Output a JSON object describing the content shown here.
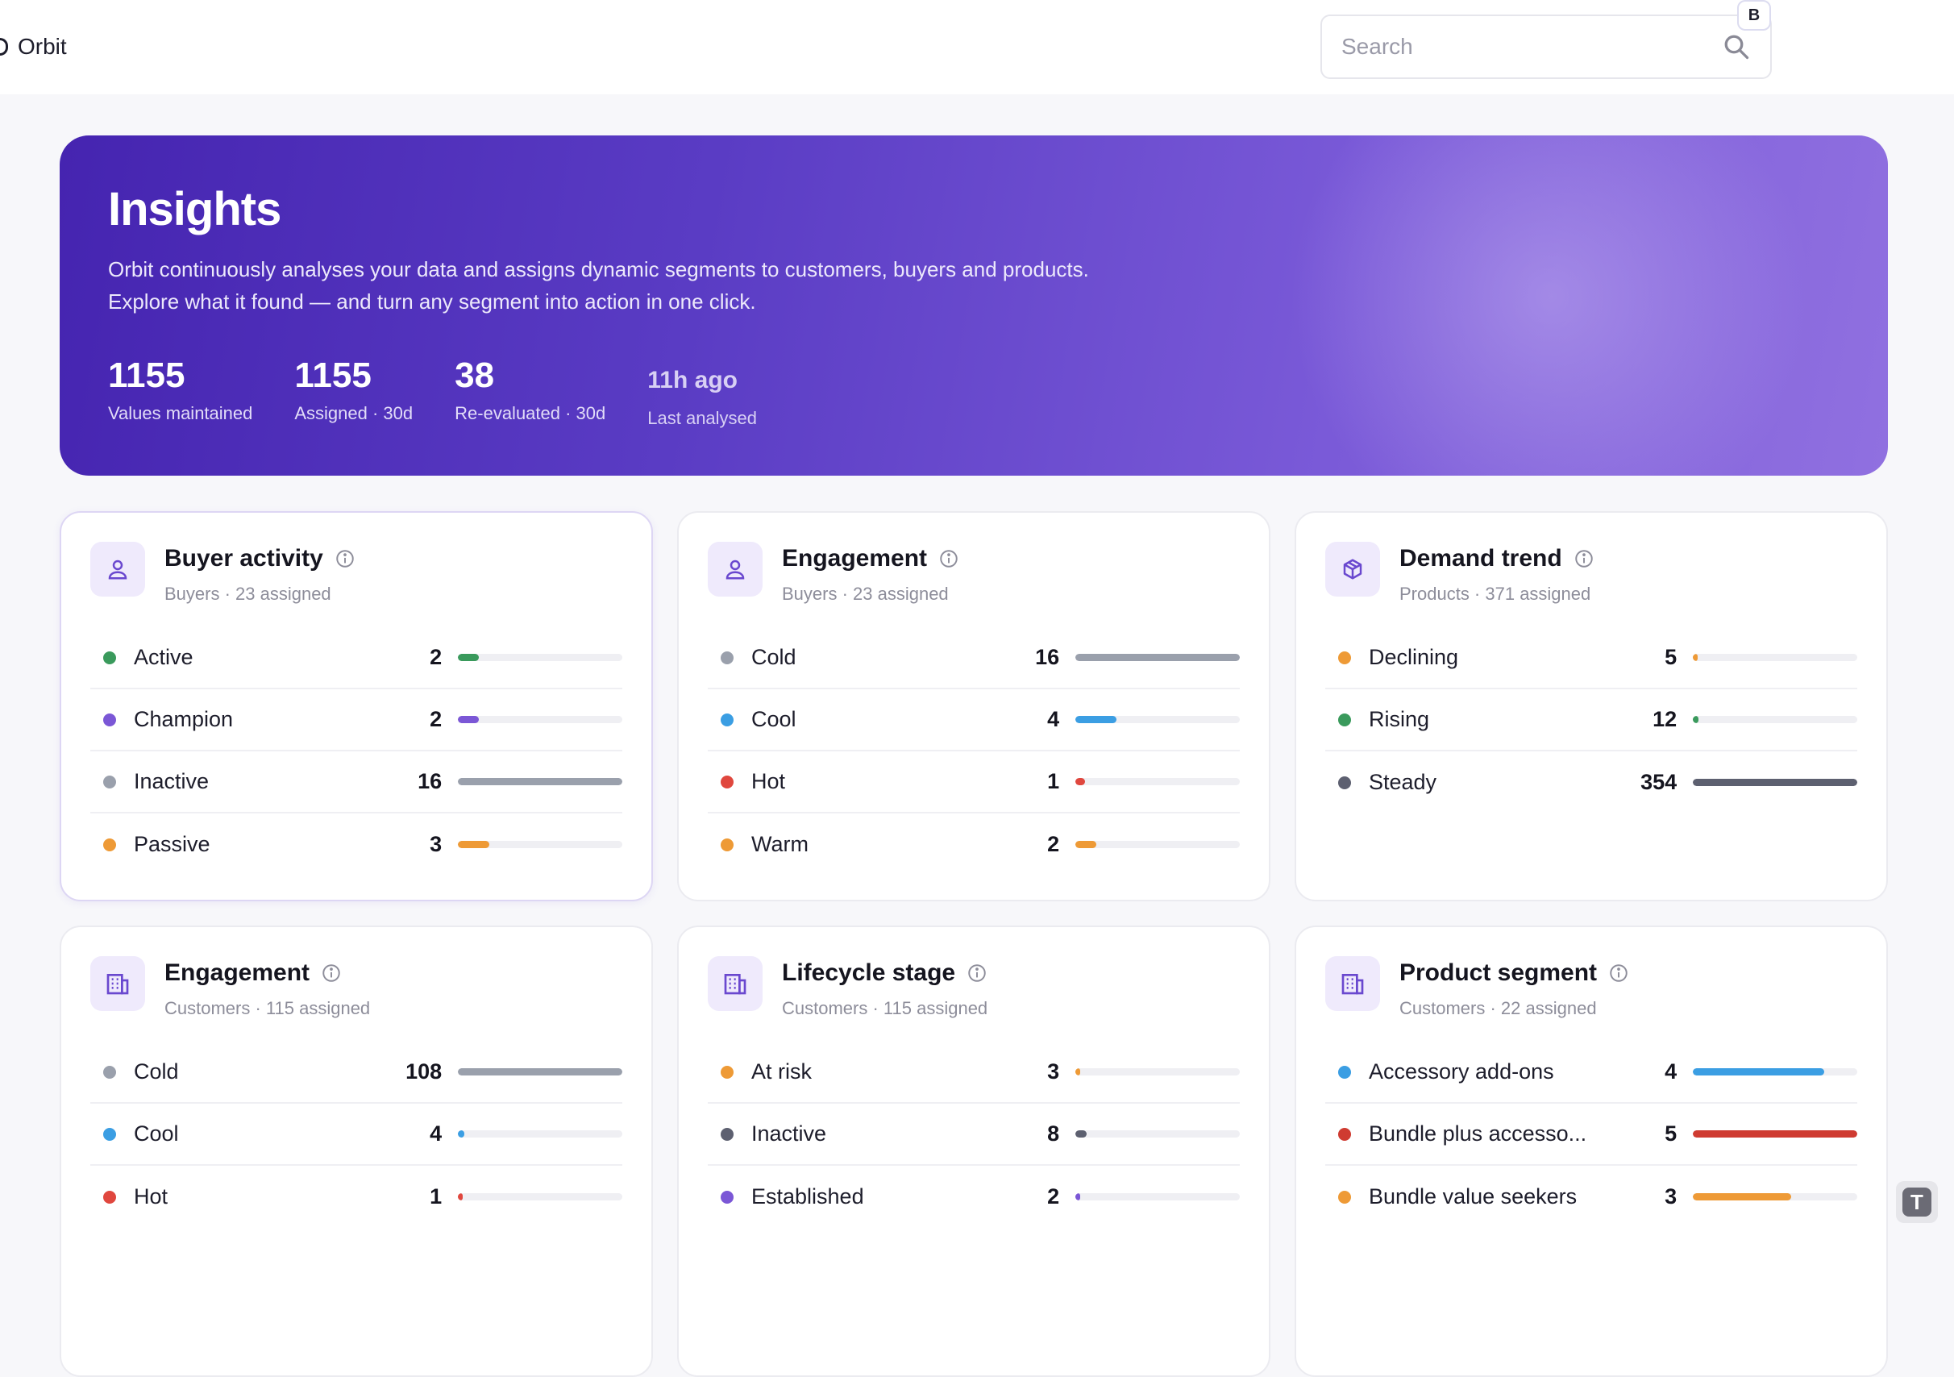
{
  "app": {
    "name": "Orbit"
  },
  "search": {
    "placeholder": "Search"
  },
  "user": {
    "initial": "B"
  },
  "hero": {
    "title": "Insights",
    "description": "Orbit continuously analyses your data and assigns dynamic segments to customers, buyers and products. Explore what it found — and turn any segment into action in one click.",
    "stats": [
      {
        "value": "1155",
        "label": "Values maintained"
      },
      {
        "value": "1155",
        "label": "Assigned · 30d"
      },
      {
        "value": "38",
        "label": "Re-evaluated · 30d"
      },
      {
        "value": "11h ago",
        "label": "Last analysed"
      }
    ]
  },
  "colors": {
    "green": "#3a9a5c",
    "purple": "#7b57d6",
    "gray": "#9aa0ac",
    "orange": "#ee9a36",
    "blue": "#3b9ee3",
    "red": "#e0473e",
    "slate": "#5d6070",
    "darkred": "#cf3b31"
  },
  "cards": [
    {
      "icon": "person-icon",
      "title": "Buyer activity",
      "subtitle": "Buyers · 23 assigned",
      "rows": [
        {
          "label": "Active",
          "count": "2",
          "color": "#3a9a5c",
          "fraction": 0.125
        },
        {
          "label": "Champion",
          "count": "2",
          "color": "#7b57d6",
          "fraction": 0.125
        },
        {
          "label": "Inactive",
          "count": "16",
          "color": "#9aa0ac",
          "fraction": 1.0
        },
        {
          "label": "Passive",
          "count": "3",
          "color": "#ee9a36",
          "fraction": 0.19
        }
      ]
    },
    {
      "icon": "person-icon",
      "title": "Engagement",
      "subtitle": "Buyers · 23 assigned",
      "rows": [
        {
          "label": "Cold",
          "count": "16",
          "color": "#9aa0ac",
          "fraction": 1.0
        },
        {
          "label": "Cool",
          "count": "4",
          "color": "#3b9ee3",
          "fraction": 0.25
        },
        {
          "label": "Hot",
          "count": "1",
          "color": "#e0473e",
          "fraction": 0.06
        },
        {
          "label": "Warm",
          "count": "2",
          "color": "#ee9a36",
          "fraction": 0.125
        }
      ]
    },
    {
      "icon": "box-icon",
      "title": "Demand trend",
      "subtitle": "Products · 371 assigned",
      "rows": [
        {
          "label": "Declining",
          "count": "5",
          "color": "#ee9a36",
          "fraction": 0.02
        },
        {
          "label": "Rising",
          "count": "12",
          "color": "#3a9a5c",
          "fraction": 0.035
        },
        {
          "label": "Steady",
          "count": "354",
          "color": "#5d6070",
          "fraction": 1.0
        }
      ]
    },
    {
      "icon": "building-icon",
      "title": "Engagement",
      "subtitle": "Customers · 115 assigned",
      "rows": [
        {
          "label": "Cold",
          "count": "108",
          "color": "#9aa0ac",
          "fraction": 1.0
        },
        {
          "label": "Cool",
          "count": "4",
          "color": "#3b9ee3",
          "fraction": 0.04
        },
        {
          "label": "Hot",
          "count": "1",
          "color": "#e0473e",
          "fraction": 0.02
        }
      ]
    },
    {
      "icon": "building-icon",
      "title": "Lifecycle stage",
      "subtitle": "Customers · 115 assigned",
      "rows": [
        {
          "label": "At risk",
          "count": "3",
          "color": "#ee9a36",
          "fraction": 0.03
        },
        {
          "label": "Inactive",
          "count": "8",
          "color": "#5d6070",
          "fraction": 0.07
        },
        {
          "label": "Established",
          "count": "2",
          "color": "#7b57d6",
          "fraction": 0.03
        }
      ]
    },
    {
      "icon": "building-icon",
      "title": "Product segment",
      "subtitle": "Customers · 22 assigned",
      "rows": [
        {
          "label": "Accessory add-ons",
          "count": "4",
          "color": "#3b9ee3",
          "fraction": 0.8
        },
        {
          "label": "Bundle plus accesso...",
          "count": "5",
          "color": "#cf3b31",
          "fraction": 1.0
        },
        {
          "label": "Bundle value seekers",
          "count": "3",
          "color": "#ee9a36",
          "fraction": 0.6
        }
      ]
    }
  ],
  "corner": {
    "glyph": "T"
  }
}
